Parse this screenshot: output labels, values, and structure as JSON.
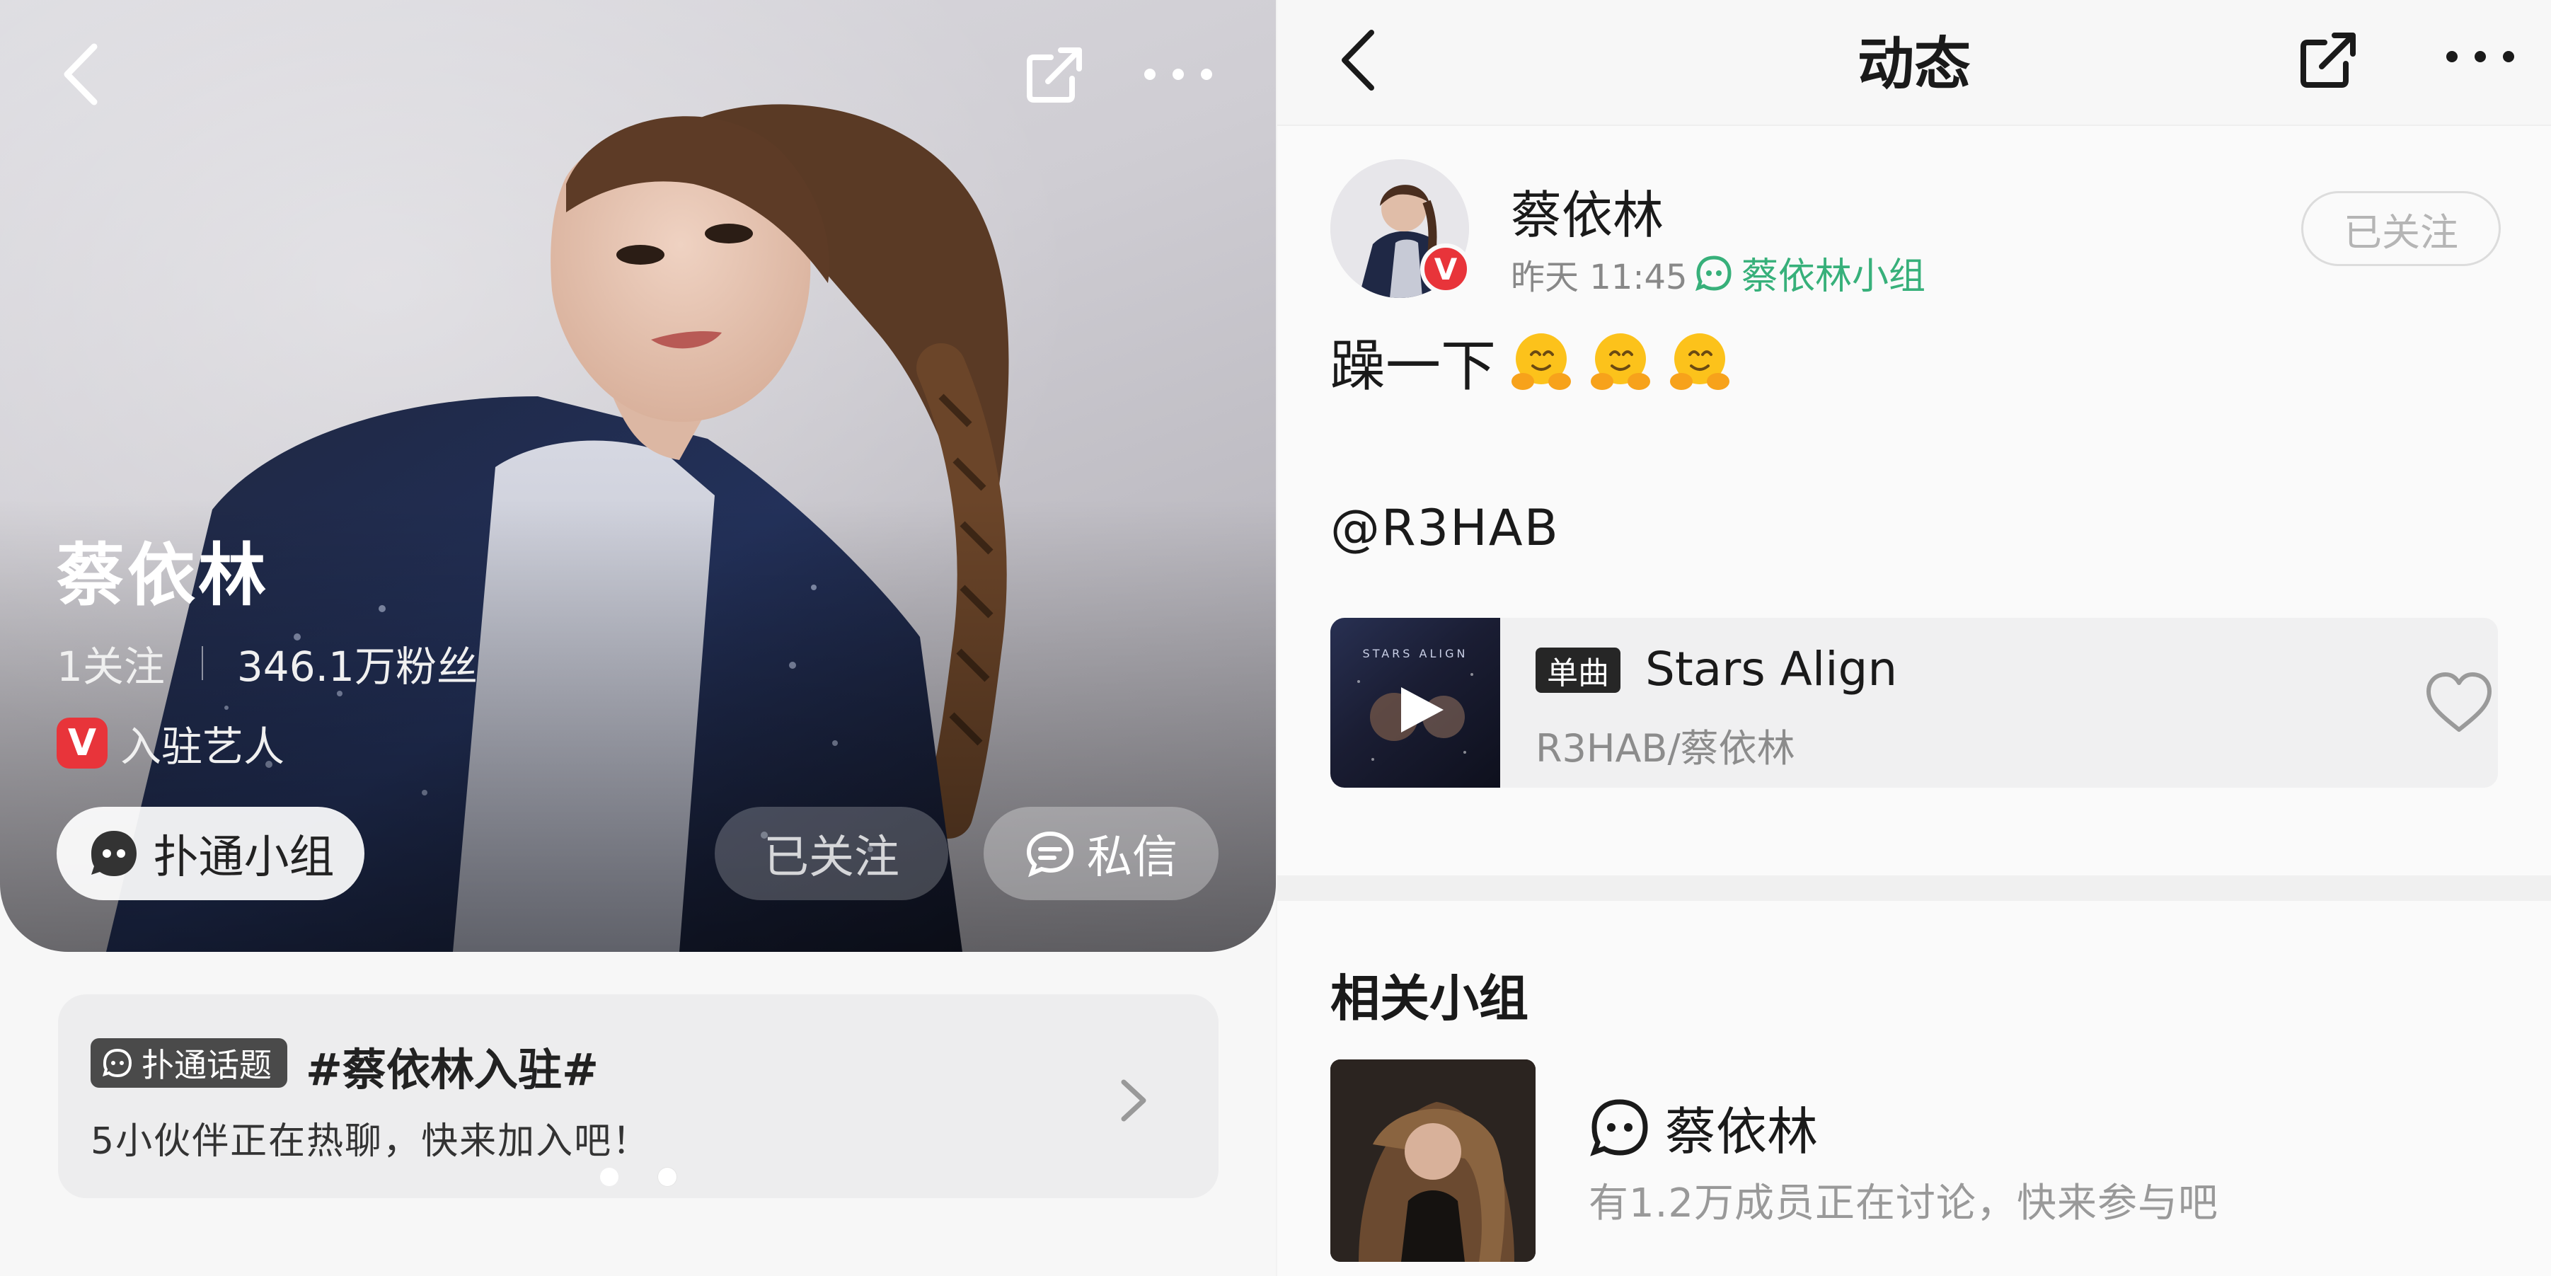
{
  "left": {
    "artist_name": "蔡依林",
    "following": "1关注",
    "fans": "346.1万粉丝",
    "verified_label": "入驻艺人",
    "verified_badge": "V",
    "group_button": "扑通小组",
    "followed_button": "已关注",
    "message_button": "私信",
    "topic": {
      "tag": "扑通话题",
      "title": "#蔡依林入驻#",
      "subtitle": "5小伙伴正在热聊，快来加入吧！"
    },
    "carousel": {
      "count": 2,
      "active_index": 1
    },
    "icons": [
      "back-arrow-icon",
      "share-icon",
      "more-icon",
      "group-icon",
      "chat-icon",
      "chevron-right-icon"
    ]
  },
  "right": {
    "header_title": "动态",
    "post": {
      "author": "蔡依林",
      "time": "昨天 11:45",
      "group": "蔡依林小组",
      "follow_state": "已关注",
      "text": "躁一下",
      "emoji_count": 3,
      "emoji_icon": "hugging-face-emoji",
      "mention": "@R3HAB",
      "avatar_badge": "V"
    },
    "song": {
      "badge": "单曲",
      "title": "Stars Align",
      "artist": "R3HAB/蔡依林",
      "cover_text": "STARS ALIGN",
      "icons": [
        "play-icon",
        "heart-icon"
      ]
    },
    "related": {
      "title": "相关小组",
      "group_name": "蔡依林",
      "group_desc": "有1.2万成员正在讨论，快来参与吧"
    }
  },
  "colors": {
    "accent_green": "#37b07a",
    "verified_red": "#e8343a",
    "topic_tag_bg": "#4a4a4a"
  }
}
